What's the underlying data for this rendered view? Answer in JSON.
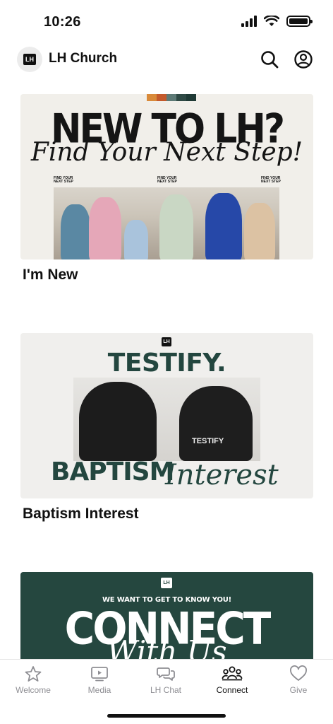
{
  "status_bar": {
    "time": "10:26"
  },
  "header": {
    "logo_text": "LH",
    "title": "LH Church",
    "icons": [
      "search-icon",
      "profile-icon"
    ]
  },
  "feed": {
    "items": [
      {
        "label": "I'm New",
        "banner": {
          "headline": "NEW TO LH?",
          "script": "Find Your Next Step!",
          "small_left": "FIND YOUR NEXT STEP",
          "small_center": "FIND YOUR NEXT STEP",
          "small_right": "FIND YOUR NEXT STEP",
          "stripe_colors": [
            "#d98a3a",
            "#c45a2c",
            "#5d7a76",
            "#2f4a45",
            "#1f3a35"
          ]
        }
      },
      {
        "label": "Baptism Interest",
        "banner": {
          "logo": "LH",
          "title": "TESTIFY.",
          "word1": "BAPTISM",
          "word2": "Interest",
          "shirt_text": "TESTIFY"
        }
      },
      {
        "label": "",
        "banner": {
          "logo": "LH",
          "sub": "WE WANT TO GET TO KNOW YOU!",
          "title": "CONNECT",
          "script": "With Us"
        }
      }
    ]
  },
  "tabs": [
    {
      "label": "Welcome",
      "icon": "star-icon",
      "active": false
    },
    {
      "label": "Media",
      "icon": "tv-play-icon",
      "active": false
    },
    {
      "label": "LH Chat",
      "icon": "chat-bubbles-icon",
      "active": false
    },
    {
      "label": "Connect",
      "icon": "people-group-icon",
      "active": true
    },
    {
      "label": "Give",
      "icon": "heart-icon",
      "active": false
    }
  ],
  "colors": {
    "brand_green": "#23463f",
    "card_bg": "#f1efea",
    "inactive_tab": "#8e8e93"
  }
}
